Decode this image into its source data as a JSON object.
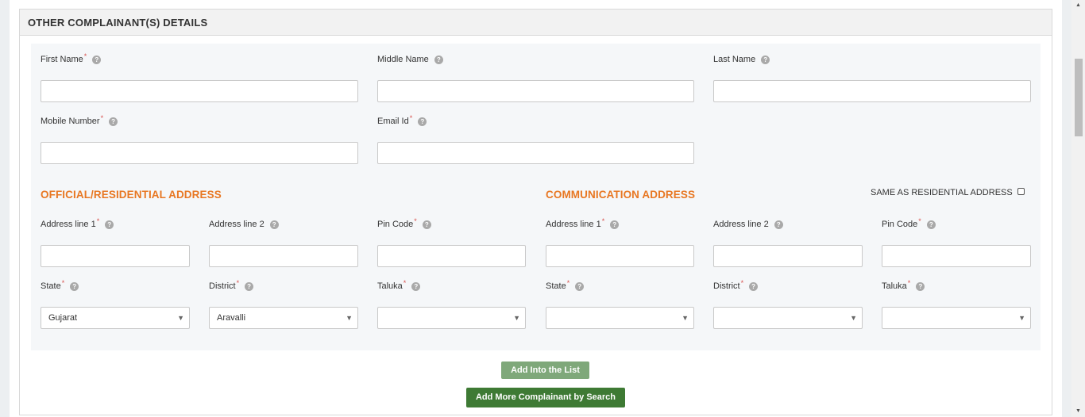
{
  "panel": {
    "title": "OTHER COMPLAINANT(S) DETAILS"
  },
  "personal": {
    "first_name": {
      "label": "First Name",
      "required": "*"
    },
    "middle_name": {
      "label": "Middle Name"
    },
    "last_name": {
      "label": "Last Name"
    },
    "mobile": {
      "label": "Mobile Number",
      "required": "*"
    },
    "email": {
      "label": "Email Id",
      "required": "*"
    }
  },
  "official_address": {
    "title": "OFFICIAL/RESIDENTIAL ADDRESS",
    "address1": {
      "label": "Address line 1",
      "required": "*"
    },
    "address2": {
      "label": "Address line 2"
    },
    "pin": {
      "label": "Pin Code",
      "required": "*"
    },
    "state": {
      "label": "State",
      "required": "*",
      "value": "Gujarat"
    },
    "district": {
      "label": "District",
      "required": "*",
      "value": "Aravalli"
    },
    "taluka": {
      "label": "Taluka",
      "required": "*",
      "value": ""
    }
  },
  "communication_address": {
    "title": "COMMUNICATION ADDRESS",
    "same_as_label": "SAME AS RESIDENTIAL ADDRESS",
    "address1": {
      "label": "Address line 1",
      "required": "*"
    },
    "address2": {
      "label": "Address line 2"
    },
    "pin": {
      "label": "Pin Code",
      "required": "*"
    },
    "state": {
      "label": "State",
      "required": "*",
      "value": ""
    },
    "district": {
      "label": "District",
      "required": "*",
      "value": ""
    },
    "taluka": {
      "label": "Taluka",
      "required": "*",
      "value": ""
    }
  },
  "icons": {
    "help": "?",
    "dropdown": "▼",
    "scroll_up": "▲",
    "scroll_down": "▼"
  },
  "buttons": {
    "add_into_list": "Add Into the List",
    "add_more_search": "Add More Complainant by Search"
  },
  "colors": {
    "section_title": "#e87722",
    "required": "#d9534f",
    "button_light": "#7fa87a",
    "button_dark": "#3e7a34"
  }
}
